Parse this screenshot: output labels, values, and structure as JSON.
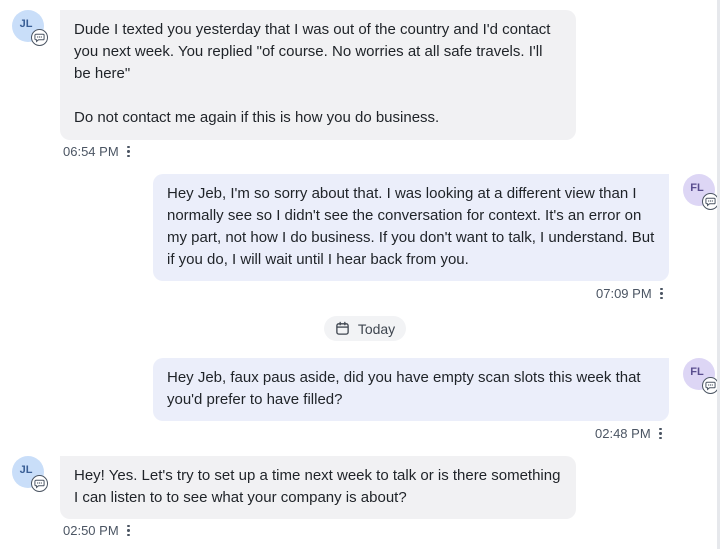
{
  "divider": {
    "label": "Today",
    "icon": "calendar-icon"
  },
  "messages": [
    {
      "direction": "incoming",
      "avatar": "JL",
      "text": "Dude I texted you yesterday that I was out of the country and I'd contact you next week. You replied \"of course. No worries at all safe travels. I'll be here\"\n\nDo not contact me again if this is how you do business.",
      "time": "06:54 PM"
    },
    {
      "direction": "outgoing",
      "avatar": "FL",
      "text": "Hey Jeb, I'm so sorry about that. I was looking at a different view than I normally see so I didn't see the conversation for context. It's an error on my part, not how I do business. If you don't want to talk, I understand. But if you do, I will wait until I hear back from you.",
      "time": "07:09 PM"
    },
    {
      "direction": "outgoing",
      "avatar": "FL",
      "text": "Hey Jeb, faux paus aside, did you have empty scan slots this week that you'd prefer to have filled?",
      "time": "02:48 PM"
    },
    {
      "direction": "incoming",
      "avatar": "JL",
      "text": "Hey! Yes. Let's try to set up a time next week to talk or is there something I can listen to to see what your company is about?",
      "time": "02:50 PM"
    }
  ],
  "colors": {
    "incoming_bubble": "#f1f1f3",
    "outgoing_bubble": "#ebeefa",
    "incoming_avatar": "#c9def9",
    "outgoing_avatar": "#ddd6f5"
  }
}
